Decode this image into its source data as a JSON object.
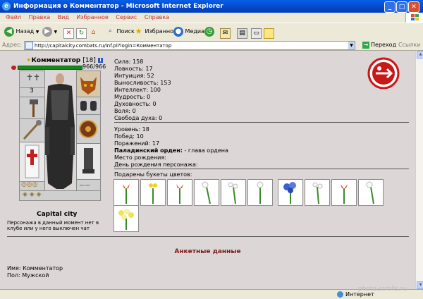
{
  "window": {
    "title": "Информация о Комментатор - Microsoft Internet Explorer"
  },
  "menu": [
    "Файл",
    "Правка",
    "Вид",
    "Избранное",
    "Сервис",
    "Справка"
  ],
  "toolbar": {
    "back": "Назад",
    "search": "Поиск",
    "favorites": "Избранное",
    "media": "Медиа"
  },
  "address": {
    "label": "Адрес:",
    "url": "http://capitalcity.combats.ru/inf.pl?login=Комментатор",
    "go": "Переход",
    "links": "Ссылки"
  },
  "character": {
    "name": "Комментатор",
    "level": "[18]",
    "hp": "966/966",
    "city": "Capital city",
    "note": "Персонажа в данный момент нет в клубе или у него выключен чат"
  },
  "stats": [
    {
      "label": "Сила:",
      "value": "158"
    },
    {
      "label": "Ловкость:",
      "value": "17"
    },
    {
      "label": "Интуиция:",
      "value": "52"
    },
    {
      "label": "Выносливость:",
      "value": "153"
    },
    {
      "label": "Интеллект:",
      "value": "100"
    },
    {
      "label": "Мудрость:",
      "value": "0"
    },
    {
      "label": "Духовность:",
      "value": "0"
    },
    {
      "label": "Воля:",
      "value": "0"
    },
    {
      "label": "Свобода духа:",
      "value": "0"
    }
  ],
  "info": {
    "level": {
      "label": "Уровень:",
      "value": "18"
    },
    "wins": {
      "label": "Побед:",
      "value": "10"
    },
    "losses": {
      "label": "Поражений:",
      "value": "17"
    },
    "order": {
      "label": "Паладинский орден:",
      "value": "- глава ордена"
    },
    "birthplace": {
      "label": "Место рождения:",
      "value": ""
    },
    "birthday": {
      "label": "День рождения персонажа:",
      "value": ""
    }
  },
  "flowers": {
    "title": "Подарены букеты цветов:",
    "items": [
      "red-tulip",
      "yellow-flowers",
      "red-tulip",
      "white-flowers",
      "white-flowers",
      "white-flowers",
      "blue-flowers",
      "white-flowers",
      "red-tulip",
      "white-flowers",
      "yellow-bouquet"
    ]
  },
  "profile": {
    "title": "Анкетные данные",
    "name_label": "Имя:",
    "name": "Комментатор",
    "gender_label": "Пол:",
    "gender": "Мужской"
  },
  "status": {
    "zone": "Интернет"
  },
  "watermark": "photo.scrolls.ru"
}
